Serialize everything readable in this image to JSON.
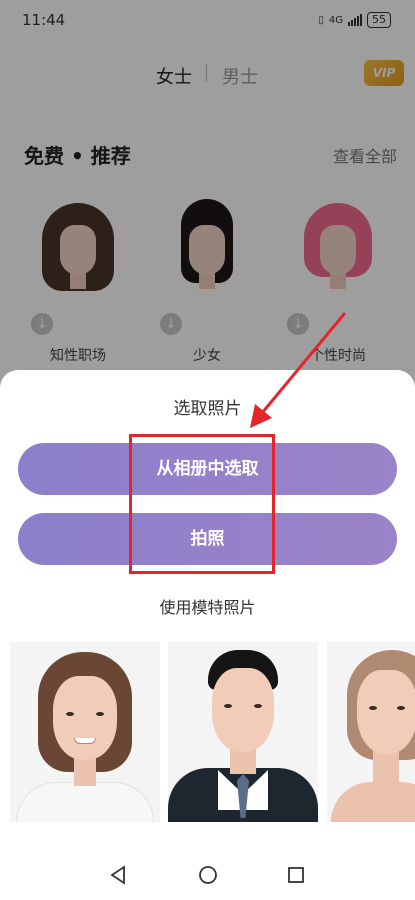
{
  "status": {
    "time": "11:44",
    "network": "4G",
    "battery": "55"
  },
  "topnav": {
    "female_tab": "女士",
    "male_tab": "男士",
    "vip_label": "VIP"
  },
  "section": {
    "title": "免费 • 推荐",
    "view_all": "查看全部"
  },
  "hairstyles": [
    {
      "label": "知性职场",
      "hair_color": "#4a3428"
    },
    {
      "label": "少女",
      "hair_color": "#1e1818"
    },
    {
      "label": "个性时尚",
      "hair_color": "#f06a8e"
    }
  ],
  "sheet": {
    "title": "选取照片",
    "album_button": "从相册中选取",
    "camera_button": "拍照",
    "model_title": "使用模特照片"
  },
  "models": [
    {
      "name": "female-model-white-shirt"
    },
    {
      "name": "male-model-suit"
    },
    {
      "name": "female-model-bare-shoulder"
    }
  ],
  "colors": {
    "accent": "#9283c9",
    "highlight": "#e3262a",
    "vip": "#f0ae2e"
  }
}
